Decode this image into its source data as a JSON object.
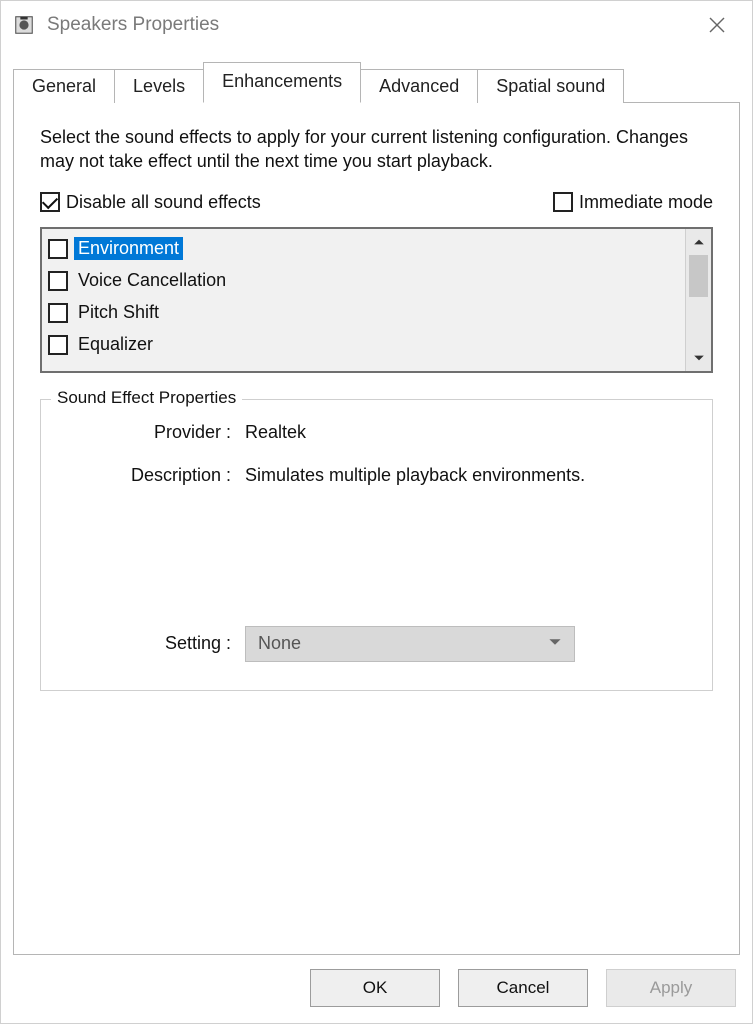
{
  "window": {
    "title": "Speakers Properties"
  },
  "tabs": [
    {
      "label": "General"
    },
    {
      "label": "Levels"
    },
    {
      "label": "Enhancements"
    },
    {
      "label": "Advanced"
    },
    {
      "label": "Spatial sound"
    }
  ],
  "active_tab_index": 2,
  "enhancements": {
    "instructions": "Select the sound effects to apply for your current listening configuration. Changes may not take effect until the next time you start playback.",
    "disable_all": {
      "label": "Disable all sound effects",
      "checked": true
    },
    "immediate_mode": {
      "label": "Immediate mode",
      "checked": false
    },
    "effects": [
      {
        "label": "Environment",
        "checked": false,
        "selected": true
      },
      {
        "label": "Voice Cancellation",
        "checked": false,
        "selected": false
      },
      {
        "label": "Pitch Shift",
        "checked": false,
        "selected": false
      },
      {
        "label": "Equalizer",
        "checked": false,
        "selected": false
      }
    ],
    "properties": {
      "legend": "Sound Effect Properties",
      "provider_label": "Provider :",
      "provider_value": "Realtek",
      "description_label": "Description :",
      "description_value": "Simulates multiple playback environments.",
      "setting_label": "Setting :",
      "setting_value": "None"
    }
  },
  "buttons": {
    "ok": "OK",
    "cancel": "Cancel",
    "apply": "Apply"
  }
}
